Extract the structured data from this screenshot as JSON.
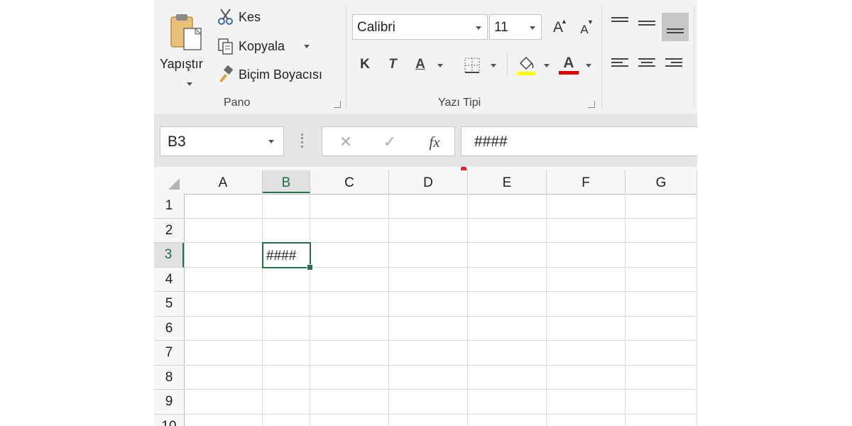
{
  "clipboard": {
    "paste_label": "Yapıştır",
    "cut_label": "Kes",
    "copy_label": "Kopyala",
    "format_painter_label": "Biçim Boyacısı",
    "group_label": "Pano"
  },
  "font": {
    "family": "Calibri",
    "size": "11",
    "grow_label": "A",
    "shrink_label": "A",
    "bold_label": "K",
    "italic_label": "T",
    "underline_label": "A",
    "font_color_label": "A",
    "fill_color": "#ffff00",
    "font_color": "#e00000",
    "group_label": "Yazı Tipi"
  },
  "formula_bar": {
    "name_box": "B3",
    "fx_label": "fx",
    "content": "####"
  },
  "grid": {
    "columns": [
      "A",
      "B",
      "C",
      "D",
      "E",
      "F",
      "G"
    ],
    "rows": [
      "1",
      "2",
      "3",
      "4",
      "5",
      "6",
      "7",
      "8",
      "9",
      "10"
    ],
    "selected_cell": "B3",
    "cell_b3": "####"
  },
  "colors": {
    "accent_green": "#217346",
    "marker_red": "#e8202a"
  }
}
